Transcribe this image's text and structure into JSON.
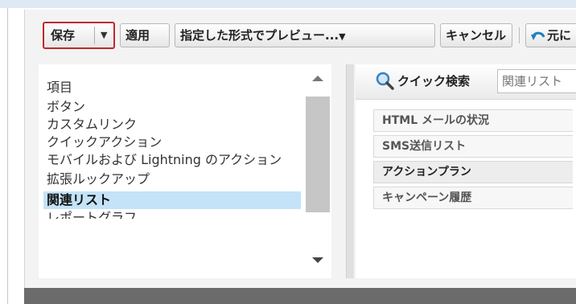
{
  "toolbar": {
    "save_label": "保存",
    "apply_label": "適用",
    "preview_label": "指定した形式でプレビュー...",
    "cancel_label": "キャンセル",
    "undo_label": "元に"
  },
  "palette": {
    "items": [
      {
        "label": "項目"
      },
      {
        "label": "ボタン"
      },
      {
        "label": "カスタムリンク"
      },
      {
        "label": "クイックアクション"
      },
      {
        "label": "モバイルおよび Lightning のアクション"
      },
      {
        "label": "拡張ルックアップ"
      },
      {
        "label": "関連リスト"
      },
      {
        "label": "レポートグラフ"
      }
    ],
    "selected_index": 6
  },
  "quick_search": {
    "label": "クイック検索",
    "placeholder": "関連リスト"
  },
  "related_lists": [
    {
      "label": "HTML メールの状況"
    },
    {
      "label": "SMS送信リスト"
    },
    {
      "label": "アクションプラン"
    },
    {
      "label": "キャンペーン履歴"
    }
  ],
  "colors": {
    "save_highlight": "#c0282d",
    "selected_bg": "#c4e3f8",
    "undo_icon": "#1f7fc4"
  }
}
